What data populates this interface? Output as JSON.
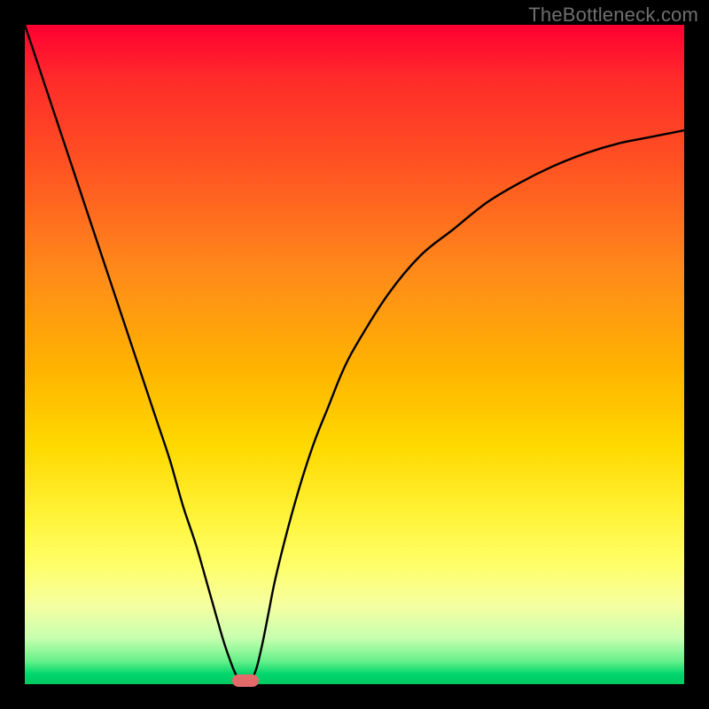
{
  "watermark": "TheBottleneck.com",
  "colors": {
    "frame": "#000000",
    "curve": "#000000",
    "marker": "#e46a6a"
  },
  "chart_data": {
    "type": "line",
    "title": "",
    "xlabel": "",
    "ylabel": "",
    "xlim": [
      0,
      100
    ],
    "ylim": [
      0,
      100
    ],
    "x": [
      0,
      2,
      4,
      6,
      8,
      10,
      12,
      14,
      16,
      18,
      20,
      22,
      24,
      26,
      28,
      30,
      31,
      32,
      33,
      34,
      35,
      36,
      37,
      38,
      40,
      42,
      44,
      46,
      48,
      50,
      55,
      60,
      65,
      70,
      75,
      80,
      85,
      90,
      95,
      100
    ],
    "y": [
      100,
      94,
      88,
      82,
      76,
      70,
      64,
      58,
      52,
      46,
      40,
      34,
      27,
      21,
      14,
      7,
      4,
      1.5,
      0.5,
      0.5,
      2,
      6,
      11,
      16,
      24,
      31,
      37,
      42,
      47,
      51,
      59,
      65,
      69,
      73,
      76,
      78.5,
      80.5,
      82,
      83,
      84
    ],
    "marker": {
      "x": 33.5,
      "y": 0.5
    },
    "gradient_meaning": "top=red (bad), bottom=green (good)"
  }
}
